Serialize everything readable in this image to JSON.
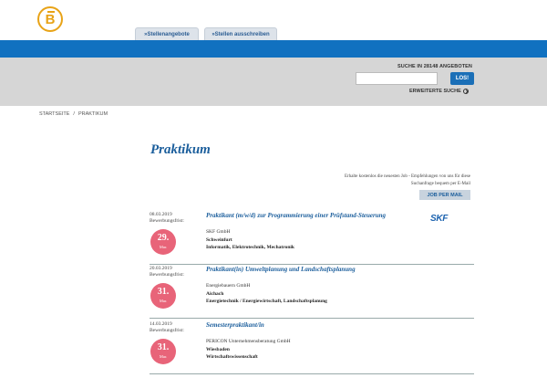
{
  "header": {
    "logo_letter": "B",
    "tabs": [
      {
        "label": "»Stellenangebote"
      },
      {
        "label": "»Stellen ausschreiben"
      }
    ]
  },
  "search": {
    "title": "SUCHE IN 28148 ANGEBOTEN",
    "value": "",
    "placeholder": "",
    "button_label": "LOS!",
    "advanced_label": "ERWEITERTE SUCHE"
  },
  "breadcrumb": {
    "home": "STARTSEITE",
    "separator": "/",
    "current": "PRAKTIKUM"
  },
  "page": {
    "title": "Praktikum",
    "email_note": "Erhalte kostenlos die neuesten Job - Empfehlungen von uns für diese Suchanfrage bequem per E-Mail",
    "mail_button": "JOB PER MAIL"
  },
  "listings": [
    {
      "date": "08.03.2019",
      "deadline_label": "Bewerbungsfrist:",
      "deadline_day": "29.",
      "deadline_month": "Mar.",
      "title": "Praktikant (m/w/d) zur Programmierung einer Prüfstand-Steuerung",
      "company": "SKF GmbH",
      "city": "Schweinfurt",
      "category": "Informatik, Elektrotechnik, Mechatronik",
      "logo_text": "SKF"
    },
    {
      "date": "20.03.2019",
      "deadline_label": "Bewerbungsfrist:",
      "deadline_day": "31.",
      "deadline_month": "Mar.",
      "title": "Praktikant(in) Umweltplanung und Landschaftsplanung",
      "company": "Energiebauern GmbH",
      "city": "Aichach",
      "category": "Energietechnik / Energiewirtschaft, Landschaftsplanung"
    },
    {
      "date": "14.03.2019",
      "deadline_label": "Bewerbungsfrist:",
      "deadline_day": "31.",
      "deadline_month": "Mar.",
      "title": "Semesterpraktikant/in",
      "company": "PERICON Unternehmensberatung GmbH",
      "city": "Wiesbaden",
      "category": "Wirtschaftswissenschaft"
    }
  ],
  "colors": {
    "brand_blue": "#1171c0",
    "title_blue": "#1b5e9c",
    "badge_pink": "#e86479",
    "logo_gold": "#e8a317"
  }
}
